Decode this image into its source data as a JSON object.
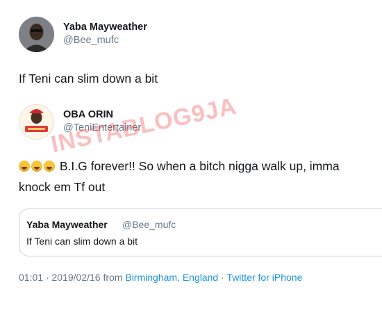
{
  "tweet": {
    "author_name": "OBA ORIN",
    "author_handle": "@TeniEntertainer",
    "text_line1": "B.I.G forever!! So when a bitch nigga walk up, imma",
    "text_line2": "knock em Tf out",
    "emoji": [
      "joy-emoji",
      "joy-emoji",
      "joy-emoji"
    ],
    "quoted": {
      "author_name": "Yaba Mayweather",
      "author_handle": "@Bee_mufc",
      "text": "If Teni can slim down a bit"
    },
    "meta": {
      "time": "01:01",
      "date": "2019/02/16",
      "from_label": "from",
      "location": "Birmingham, England",
      "client": "Twitter for iPhone",
      "separator": "·"
    }
  },
  "original_tweet": {
    "author_name": "Yaba Mayweather",
    "author_handle": "@Bee_mufc",
    "text": "If Teni can slim down a bit"
  },
  "watermark": "INSTABLOG9JA",
  "colors": {
    "text": "#14171a",
    "secondary": "#657786",
    "link": "#1b95e0",
    "border": "#ccd6dd"
  }
}
